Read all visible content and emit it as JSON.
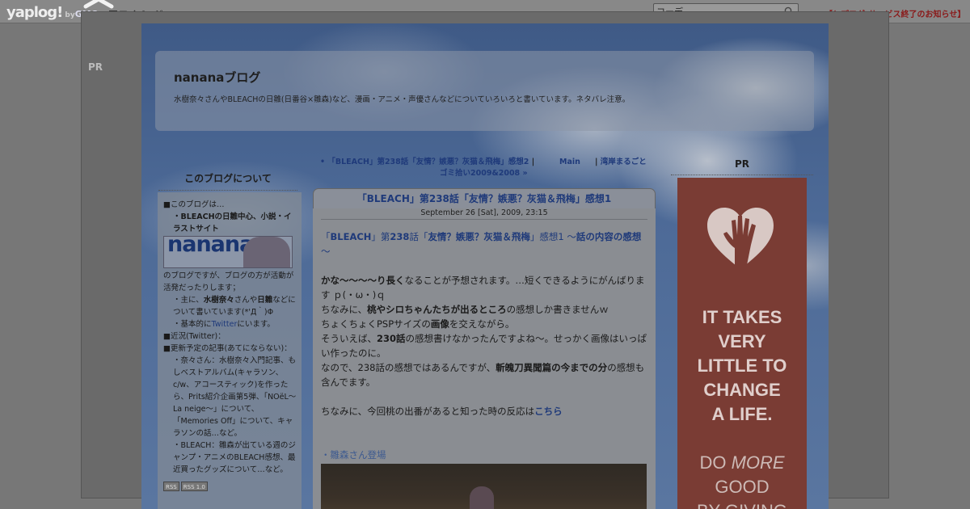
{
  "topbar": {
    "logo_main": "yaplog!",
    "logo_by": "by",
    "logo_gmo": "GMO",
    "mypage_label": "マイページ",
    "search_value": "コーデ",
    "notice_label": "【ヤプログ!サービス終了のお知らせ】"
  },
  "frame": {
    "pr_label": "PR"
  },
  "header": {
    "title": "nananaブログ",
    "description": "水樹奈々さんやBLEACHの日雛(日番谷×雛森)など、漫画・アニメ・声優さんなどについていろいろと書いています。ネタバレ注意。"
  },
  "sidebar": {
    "title": "このブログについて",
    "l1": "■このブログは…",
    "l2": "・BLEACHの日雛中心、小説・イラストサイト",
    "banner_text": "nanana",
    "l3": "のブログですが、ブログの方が活動が活発だったりします；",
    "l4a": "・主に、",
    "l4b": "水樹奈々",
    "l4c": "さんや",
    "l4d": "日雛",
    "l4e": "などについて書いています(*'Д｀)Φ",
    "l5a": "・基本的に",
    "l5b": "Twitter",
    "l5c": "にいます。",
    "l6": "■近況(Twitter)：",
    "l7": "■更新予定の記事(あてにならない)：",
    "l8": "・奈々さん：水樹奈々入門記事、もしベストアルバム(キャラソン、c/w、アコースティック)を作ったら、Prits紹介企画第5弾、「NOëL～La neige～」について、「Memories Off」について、キャラソンの話…など。",
    "l9": "・BLEACH：雛森が出ている週のジャンプ・アニメのBLEACH感想、最近買ったグッズについて…など。",
    "rss1": "RSS",
    "rss2": "RSS 1.0"
  },
  "nav": {
    "prev_label": "「BLEACH」第238話「友情？嫉悪？灰猫＆飛梅」感想2",
    "sep1": "|",
    "main_label": "Main",
    "sep2": "|",
    "next_label": "湾岸まるごと",
    "next_label2": "ゴミ拾い2009&2008 »"
  },
  "post": {
    "title": "「BLEACH」第238話「友情？嫉悪？灰猫＆飛梅」感想1",
    "date": "September 26 [Sat], 2009, 23:15",
    "h1": "「",
    "h2": "BLEACH",
    "h3": "」第",
    "h4": "238",
    "h5": "話「",
    "h6": "友情？嫉悪？灰猫＆飛梅",
    "h7": "」感想1 ～",
    "h8": "話の内容の感想",
    "h9": "～",
    "p1a": "かな～～～～り長く",
    "p1b": "なることが予想されます。…短くできるようにがんばります ｐ(・ω・)ｑ",
    "p2a": "ちなみに、",
    "p2b": "桃やシロちゃんたちが出るところ",
    "p2c": "の感想しか書きませんｗ",
    "p3a": "ちょくちょくPSPサイズの",
    "p3b": "画像",
    "p3c": "を交えながら。",
    "p4a": "そういえば、",
    "p4b": "230話",
    "p4c": "の感想書けなかったんですよね～。せっかく画像はいっぱい作ったのに。",
    "p5a": "なので、238話の感想ではあるんですが、",
    "p5b": "斬魄刀異聞篇の今までの分",
    "p5c": "の感想も含んでます。",
    "p6a": "ちなみに、今回桃の出番があると知った時の反応は",
    "p6b": "こちら",
    "section": "・雛森さん登場"
  },
  "right": {
    "pr_label": "PR",
    "ad_l1": "IT TAKES",
    "ad_l2": "VERY",
    "ad_l3": "LITTLE TO",
    "ad_l4": "CHANGE",
    "ad_l5": "A LIFE.",
    "ad_m1": "DO ",
    "ad_m2": "MORE",
    "ad_m3": "GOOD",
    "ad_m4": "BY GIVING"
  }
}
